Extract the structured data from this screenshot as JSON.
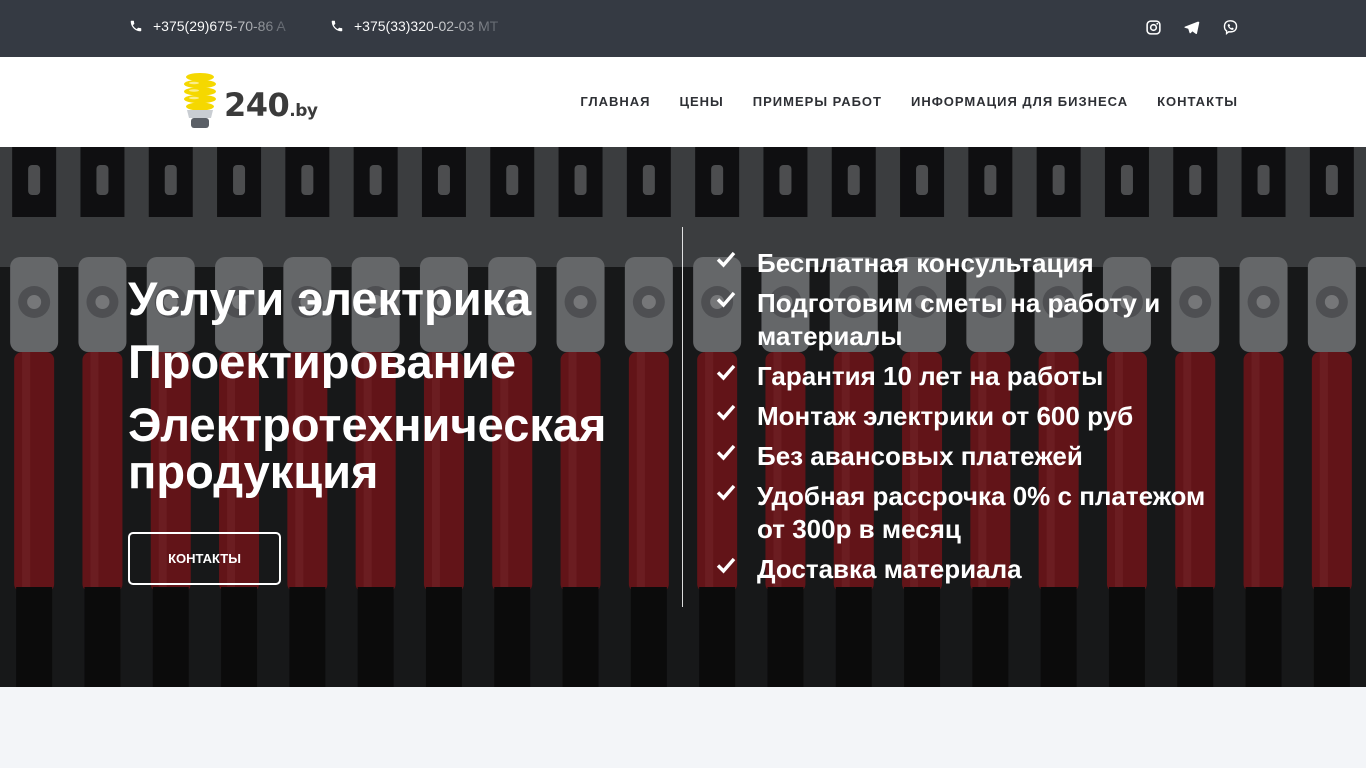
{
  "topbar": {
    "phones": [
      {
        "number": "+375(29)675-70-86 A",
        "icon": "phone-icon"
      },
      {
        "number": "+375(33)320-02-03 MT",
        "icon": "phone-icon"
      }
    ],
    "social": [
      "instagram-icon",
      "telegram-icon",
      "viber-icon"
    ],
    "bg_color": "#353a43"
  },
  "header": {
    "logo_text": "240",
    "logo_suffix": ".by",
    "nav": [
      "ГЛАВНАЯ",
      "ЦЕНЫ",
      "ПРИМЕРЫ РАБОТ",
      "ИНФОРМАЦИЯ ДЛЯ БИЗНЕСА",
      "КОНТАКТЫ"
    ]
  },
  "hero": {
    "titles": [
      "Услуги электрика",
      "Проектирование",
      "Электротехническая продукция"
    ],
    "button_label": "КОНТАКТЫ",
    "features": [
      "Бесплатная консультация",
      "Подготовим сметы на работу и материалы",
      "Гарантия 10 лет на работы",
      "Монтаж электрики от 600 руб",
      "Без авансовых платежей",
      "Удобная рассрочка 0% с платежом от 300р в месяц",
      "Доставка материала"
    ],
    "accent_color": "#b3262d"
  }
}
